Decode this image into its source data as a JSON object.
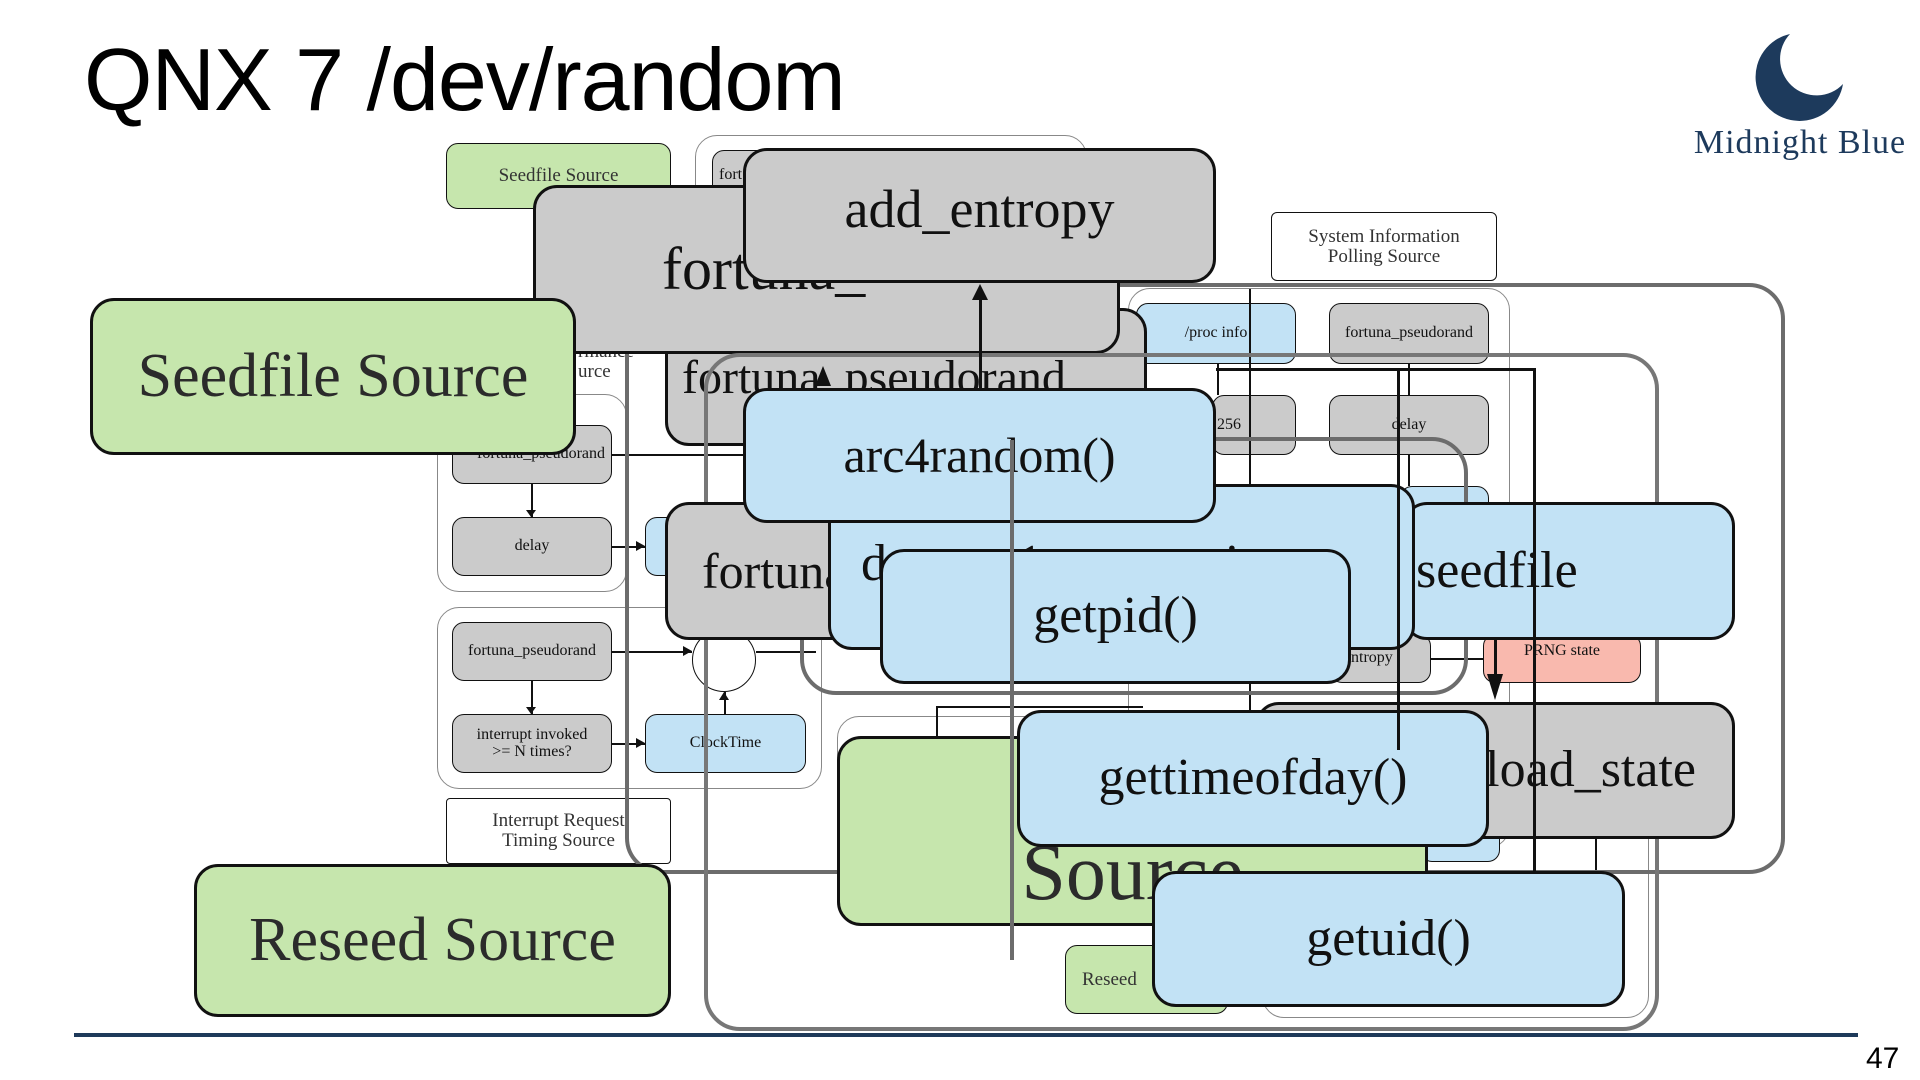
{
  "slide": {
    "title": "QNX 7 /dev/random",
    "page_number": "47",
    "logo": {
      "text": "Midnight Blue",
      "icon": "crescent-moon-icon",
      "color": "#1d3a5c"
    },
    "footer_line_color": "#1e3a5a"
  },
  "colors": {
    "source_green": "#c6e6ad",
    "process_gray": "#cbcbcb",
    "input_blue": "#c2e2f5",
    "state_pink": "#f9b9ae"
  },
  "diagram": {
    "small_labels": {
      "seedfile_source": "Seedfile Source",
      "fortuna_top_partial": "fort",
      "system_information_polling_source": "System Information\nPolling Source",
      "proc_info": "/proc info",
      "fortuna_pseudorand_sys": "fortuna_pseudorand",
      "sha256_partial": "256",
      "delay_sys": "delay",
      "performance_source_partial": "rmance\nurce",
      "fortuna_pseudorand_perf": "fortuna_pseudorand",
      "delay_perf": "delay",
      "fortuna_pseudorand_irq": "fortuna_pseudorand",
      "interrupt_invoked": "interrupt invoked\n>= N times?",
      "clocktime": "ClockTime",
      "interrupt_request_timing_source": "Interrupt Request\nTiming Source",
      "add_entropy_partial": "ntropy",
      "prng_state": "PRNG state",
      "reseed_small": "Reseed"
    },
    "large_labels": {
      "fortuna_top": "fortuna_",
      "add_entropy": "add_entropy",
      "seedfile_source": "Seedfile Source",
      "fortuna_pseudorand": "fortuna_pseudorand",
      "arc4random": "arc4random()",
      "fortuna_mid": "fortuna",
      "dev_write_partial": "d          1              ite",
      "seedfile": "seedfile",
      "getpid": "getpid()",
      "load_state": "load_state",
      "user_source": "User\nSource",
      "gettimeofday": "gettimeofday()",
      "reseed_source": "Reseed Source",
      "getuid": "getuid()"
    }
  }
}
